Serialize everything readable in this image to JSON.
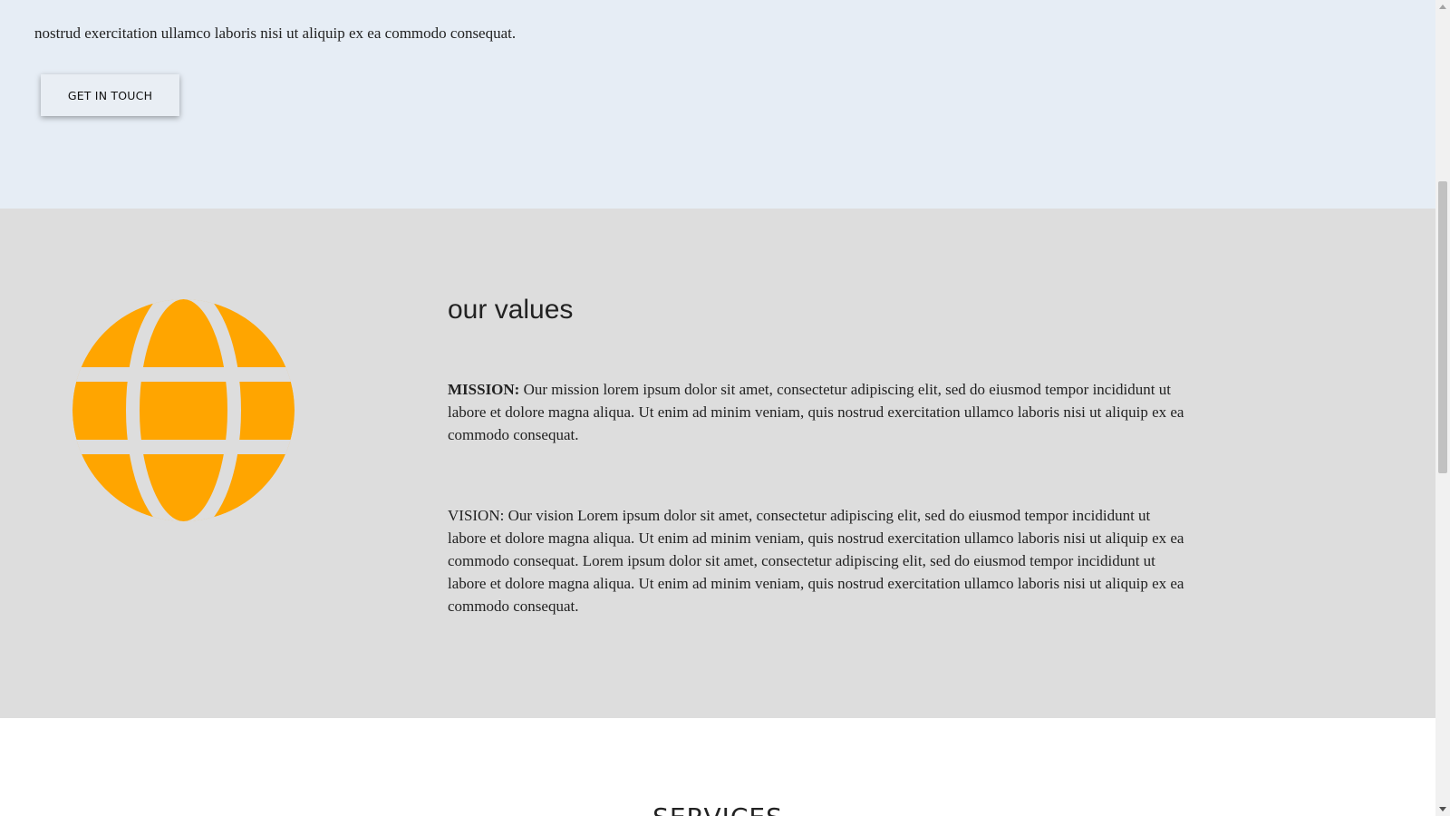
{
  "hero": {
    "text": "nostrud exercitation ullamco laboris nisi ut aliquip ex ea commodo consequat.",
    "button_label": "GET IN TOUCH"
  },
  "values": {
    "icon": "globe-icon",
    "icon_color": "#ffa500",
    "background": "#dddddd",
    "title": "our values",
    "mission_label": "MISSION:",
    "mission_text": " Our mission lorem ipsum dolor sit amet, consectetur adipiscing elit, sed do eiusmod tempor incididunt ut labore et dolore magna aliqua. Ut enim ad minim veniam, quis nostrud exercitation ullamco laboris nisi ut aliquip ex ea commodo consequat.",
    "vision_text": "VISION: Our vision Lorem ipsum dolor sit amet, consectetur adipiscing elit, sed do eiusmod tempor incididunt ut labore et dolore magna aliqua. Ut enim ad minim veniam, quis nostrud exercitation ullamco laboris nisi ut aliquip ex ea commodo consequat. Lorem ipsum dolor sit amet, consectetur adipiscing elit, sed do eiusmod tempor incididunt ut labore et dolore magna aliqua. Ut enim ad minim veniam, quis nostrud exercitation ullamco laboris nisi ut aliquip ex ea commodo consequat."
  },
  "services": {
    "title": "SERVICES"
  },
  "colors": {
    "hero_bg": "#e6edf5",
    "values_bg": "#dddddd",
    "accent": "#ffa500"
  }
}
